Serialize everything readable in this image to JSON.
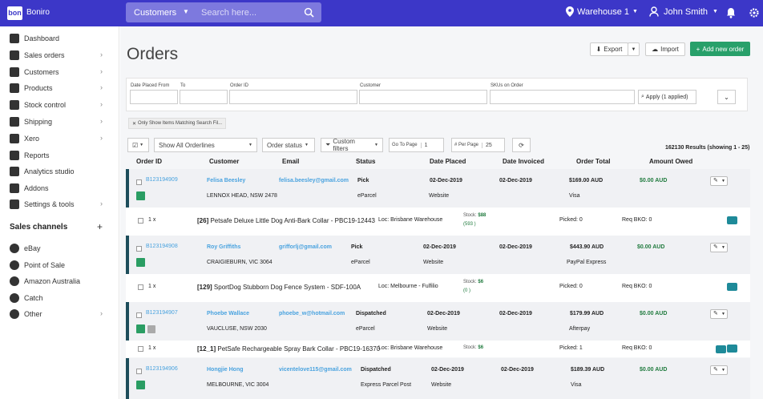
{
  "topbar": {
    "brand": "Boniro",
    "logo_text": "bon",
    "search_scope": "Customers",
    "search_placeholder": "Search here...",
    "warehouse": "Warehouse 1",
    "user": "John Smith"
  },
  "sidebar": {
    "items": [
      {
        "label": "Dashboard",
        "icon": "home-icon",
        "chevron": false
      },
      {
        "label": "Sales orders",
        "icon": "receipt-icon",
        "chevron": true
      },
      {
        "label": "Customers",
        "icon": "users-icon",
        "chevron": true
      },
      {
        "label": "Products",
        "icon": "box-icon",
        "chevron": true
      },
      {
        "label": "Stock control",
        "icon": "checkbox-icon",
        "chevron": true
      },
      {
        "label": "Shipping",
        "icon": "truck-icon",
        "chevron": true
      },
      {
        "label": "Xero",
        "icon": "xero-icon",
        "chevron": true
      },
      {
        "label": "Reports",
        "icon": "report-icon",
        "chevron": false
      },
      {
        "label": "Analytics studio",
        "icon": "analytics-icon",
        "chevron": false
      },
      {
        "label": "Addons",
        "icon": "plus-square-icon",
        "chevron": false
      },
      {
        "label": "Settings & tools",
        "icon": "gear-icon",
        "chevron": true
      }
    ],
    "channels_heading": "Sales channels",
    "channels": [
      {
        "label": "eBay",
        "icon": "ebay-icon",
        "chevron": false
      },
      {
        "label": "Point of Sale",
        "icon": "store-icon",
        "chevron": false
      },
      {
        "label": "Amazon Australia",
        "icon": "amazon-icon",
        "chevron": false
      },
      {
        "label": "Catch",
        "icon": "catch-icon",
        "chevron": false
      },
      {
        "label": "Other",
        "icon": "sitemap-icon",
        "chevron": true
      }
    ]
  },
  "page": {
    "title": "Orders",
    "export": "Export",
    "import": "Import",
    "add": "Add new order"
  },
  "filters": {
    "date_from": "Date Placed From",
    "to": "To",
    "order_id": "Order ID",
    "customer": "Customer",
    "skus": "SKUs on Order",
    "apply": "Apply (1 applied)",
    "chip": "Only Show Items Matching Search Fil..."
  },
  "toolbar": {
    "show": "Show All Orderlines",
    "status": "Order status",
    "custom": "Custom filters",
    "goto_label": "Go To Page",
    "goto_value": "1",
    "perpage_label": "# Per Page",
    "perpage_value": "25",
    "results": "162130 Results (showing 1 - 25)"
  },
  "columns": [
    "Order ID",
    "Customer",
    "Email",
    "Status",
    "Date Placed",
    "Date Invoiced",
    "Order Total",
    "Amount Owed"
  ],
  "orders": [
    {
      "id": "B123194909",
      "customer": "Felisa Beesley",
      "email": "felisa.beesley@gmail.com",
      "status": "Pick",
      "placed": "02-Dec-2019",
      "invoiced": "02-Dec-2019",
      "total": "$169.00 AUD",
      "owed": "$0.00 AUD",
      "address": "LENNOX HEAD, NSW 2478",
      "carrier": "eParcel",
      "channel": "Website",
      "payment": "Visa",
      "line": {
        "qty": "1 x",
        "sku_id": "[26]",
        "name": "Petsafe Deluxe Little Dog Anti-Bark Collar - PBC19-12443",
        "loc": "Loc: Brisbane Warehouse",
        "stock_label": "Stock:",
        "stock": "$88",
        "stock2": "(593 )",
        "picked": "Picked: 0",
        "req": "Req BKO: 0"
      }
    },
    {
      "id": "B123194908",
      "customer": "Roy Griffiths",
      "email": "grifforlj@gmail.com",
      "status": "Pick",
      "placed": "02-Dec-2019",
      "invoiced": "02-Dec-2019",
      "total": "$443.90 AUD",
      "owed": "$0.00 AUD",
      "address": "CRAIGIEBURN, VIC 3064",
      "carrier": "eParcel",
      "channel": "Website",
      "payment": "PayPal Express",
      "line": {
        "qty": "1 x",
        "sku_id": "[129]",
        "name": "SportDog Stubborn Dog Fence System - SDF-100A",
        "loc": "Loc: Melbourne - Fulfilio",
        "stock_label": "Stock:",
        "stock": "$6",
        "stock2": "(0 )",
        "picked": "Picked: 0",
        "req": "Req BKO: 0"
      }
    },
    {
      "id": "B123194907",
      "customer": "Phoebe Wallace",
      "email": "phoebe_w@hotmail.com",
      "status": "Dispatched",
      "placed": "02-Dec-2019",
      "invoiced": "02-Dec-2019",
      "total": "$179.99 AUD",
      "owed": "$0.00 AUD",
      "address": "VAUCLUSE, NSW 2030",
      "carrier": "eParcel",
      "channel": "Website",
      "payment": "Afterpay",
      "line": {
        "qty": "1 x",
        "sku_id": "[12_1]",
        "name": "PetSafe Rechargeable Spray Bark Collar - PBC19-16370",
        "loc": "Loc: Brisbane Warehouse",
        "stock_label": "Stock:",
        "stock": "$6",
        "stock2": "",
        "picked": "Picked: 1",
        "req": "Req BKO: 0"
      }
    },
    {
      "id": "B123194906",
      "customer": "Hongjie Hong",
      "email": "vicentelove115@gmail.com",
      "status": "Dispatched",
      "placed": "02-Dec-2019",
      "invoiced": "02-Dec-2019",
      "total": "$189.39 AUD",
      "owed": "$0.00 AUD",
      "address": "MELBOURNE, VIC 3004",
      "carrier": "Express Parcel Post",
      "channel": "Website",
      "payment": "Visa"
    }
  ]
}
